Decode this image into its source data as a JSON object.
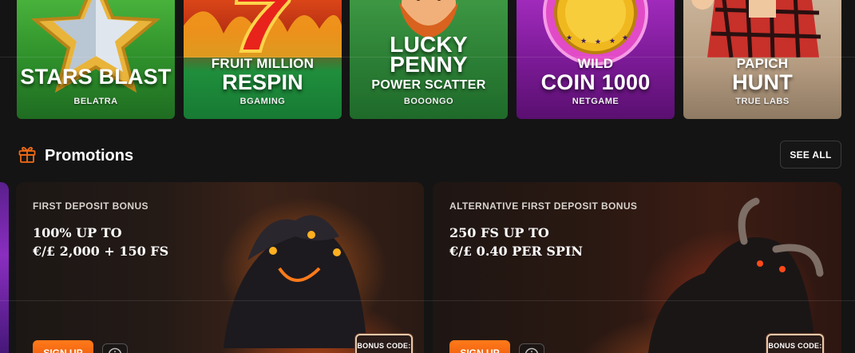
{
  "games": [
    {
      "sub": "",
      "main": "STARS BLAST",
      "provider": "BELATRA"
    },
    {
      "sub": "FRUIT MILLION",
      "main": "RESPIN",
      "provider": "BGAMING"
    },
    {
      "sub": "LUCKY",
      "main": "PENNY",
      "sub2": "POWER SCATTER",
      "provider": "BOOONGO"
    },
    {
      "sub": "WILD",
      "main": "COIN 1000",
      "provider": "NETGAME"
    },
    {
      "sub": "PAPICH",
      "main": "HUNT",
      "provider": "TRUE LABS"
    }
  ],
  "promotions": {
    "title": "Promotions",
    "see_all": "SEE ALL",
    "icon": "gift-icon",
    "cards": [
      {
        "label": "FIRST DEPOSIT BONUS",
        "line1": "100% UP TO",
        "line2": "€/£ 2,000 + 150 FS",
        "cta": "SIGN UP",
        "bonus": "BONUS CODE:"
      },
      {
        "label": "ALTERNATIVE FIRST DEPOSIT BONUS",
        "line1": "250 FS UP TO",
        "line2": "€/£ 0.40 PER SPIN",
        "cta": "SIGN UP",
        "bonus": "BONUS CODE:"
      }
    ]
  },
  "colors": {
    "accent": "#f06a16",
    "background": "#141414"
  }
}
